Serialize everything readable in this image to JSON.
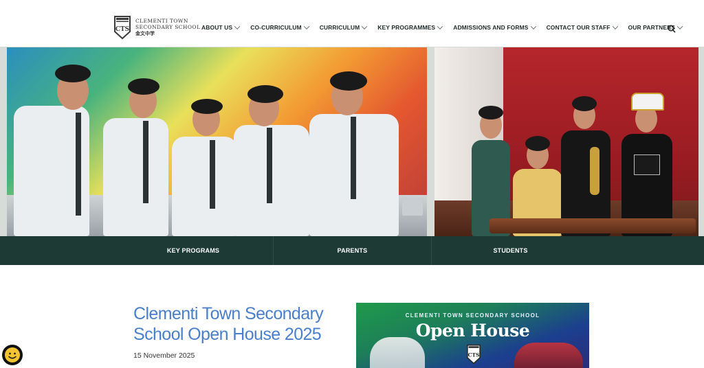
{
  "header": {
    "school_name_line1": "CLEMENTI TOWN",
    "school_name_line2": "SECONDARY SCHOOL",
    "school_name_chinese": "金文中学",
    "crest_letters": "CTS"
  },
  "nav": {
    "items": [
      {
        "label": "ABOUT US"
      },
      {
        "label": "CO-CURRICULUM"
      },
      {
        "label": "CURRICULUM"
      },
      {
        "label": "KEY PROGRAMMES"
      },
      {
        "label": "ADMISSIONS AND FORMS"
      },
      {
        "label": "CONTACT OUR STAFF"
      },
      {
        "label": "OUR PARTNERS"
      }
    ],
    "search_icon": "search-icon"
  },
  "quick_links": [
    {
      "label": "KEY PROGRAMS"
    },
    {
      "label": "PARENTS"
    },
    {
      "label": "STUDENTS"
    }
  ],
  "article": {
    "title": "Clementi Town Secondary School Open House 2025",
    "date": "15 November 2025"
  },
  "feature_image": {
    "top_text": "CLEMENTI TOWN SECONDARY SCHOOL",
    "title": "Open House",
    "crest_letters": "CTS"
  },
  "colors": {
    "accent_blue": "#4a7fcb",
    "quickbar_green": "#1d3a35",
    "curtain_red": "#b5262b"
  }
}
